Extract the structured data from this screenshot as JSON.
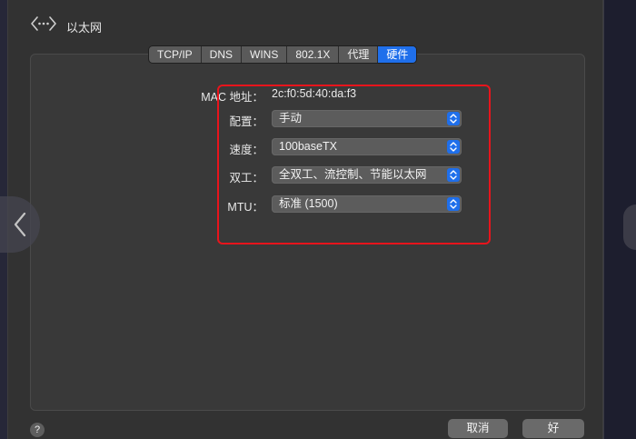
{
  "window": {
    "title": "以太网"
  },
  "tabs": [
    {
      "label": "TCP/IP",
      "active": false
    },
    {
      "label": "DNS",
      "active": false
    },
    {
      "label": "WINS",
      "active": false
    },
    {
      "label": "802.1X",
      "active": false
    },
    {
      "label": "代理",
      "active": false
    },
    {
      "label": "硬件",
      "active": true
    }
  ],
  "hardware": {
    "mac_label": "MAC 地址：",
    "mac_value": "2c:f0:5d:40:da:f3",
    "config_label": "配置：",
    "config_value": "手动",
    "speed_label": "速度：",
    "speed_value": "100baseTX",
    "duplex_label": "双工：",
    "duplex_value": "全双工、流控制、节能以太网",
    "mtu_label": "MTU：",
    "mtu_value": "标准 (1500)"
  },
  "footer": {
    "help_label": "?",
    "cancel_label": "取消",
    "ok_label": "好"
  },
  "colors": {
    "accent": "#1f6feb",
    "highlight": "#e8141c"
  },
  "icons": {
    "title": "network-ethernet-icon",
    "nav_prev": "chevron-left-icon",
    "select": "chevron-updown-icon"
  }
}
